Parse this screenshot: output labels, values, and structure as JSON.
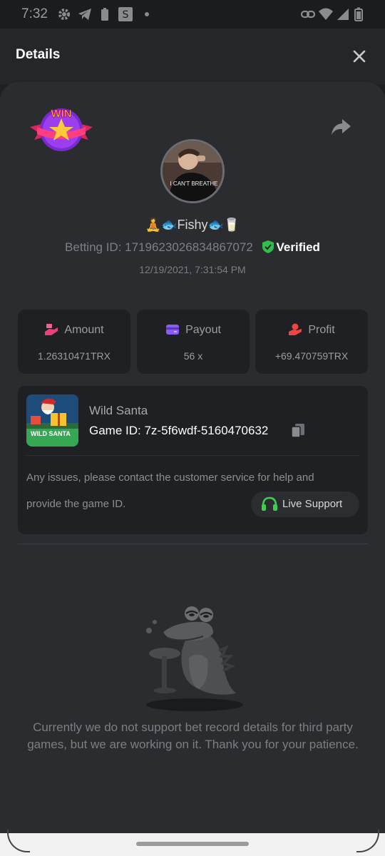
{
  "status_bar": {
    "time": "7:32",
    "left_icons": [
      "gear-icon",
      "telegram-icon",
      "battery-saver-icon",
      "s-app-icon",
      "dot-icon"
    ],
    "right_icons": [
      "link-icon",
      "wifi-icon",
      "signal-icon",
      "battery-icon"
    ]
  },
  "header": {
    "title": "Details",
    "close_icon": "close-icon"
  },
  "result": {
    "badge_text": "WIN",
    "share_icon": "share-icon"
  },
  "user": {
    "name": "🧘🐟Fishy🐟🥛",
    "avatar_shirt_text": "I CAN'T BREATHE",
    "betting_id": "Betting ID: 1719623026834867072",
    "verified": "Verified",
    "datetime": "12/19/2021, 7:31:54 PM"
  },
  "stats": [
    {
      "label": "Amount",
      "value": "1.26310471TRX",
      "icon": "bet-hand-icon",
      "color": "#ec407a"
    },
    {
      "label": "Payout",
      "value": "56 x",
      "icon": "wallet-icon",
      "color": "#8a5cf6"
    },
    {
      "label": "Profit",
      "value": "+69.470759TRX",
      "icon": "money-hand-icon",
      "color": "#ef4444"
    }
  ],
  "game": {
    "name": "Wild Santa",
    "game_id": "Game ID: 7z-5f6wdf-5160470632",
    "thumb_text": "WILD SANTA",
    "issues_line1": "Any issues, please contact the customer service for help and",
    "issues_line2": "provide the game ID.",
    "live_support": "Live Support"
  },
  "notice": "Currently we do not support bet record details for third party games, but we are working on it. Thank you for your patience.",
  "colors": {
    "background": "#1f2023",
    "sheet": "#2b2c30",
    "card": "#1f2023",
    "verified_green": "#2fbf4f",
    "support_green": "#3ccf4e"
  }
}
